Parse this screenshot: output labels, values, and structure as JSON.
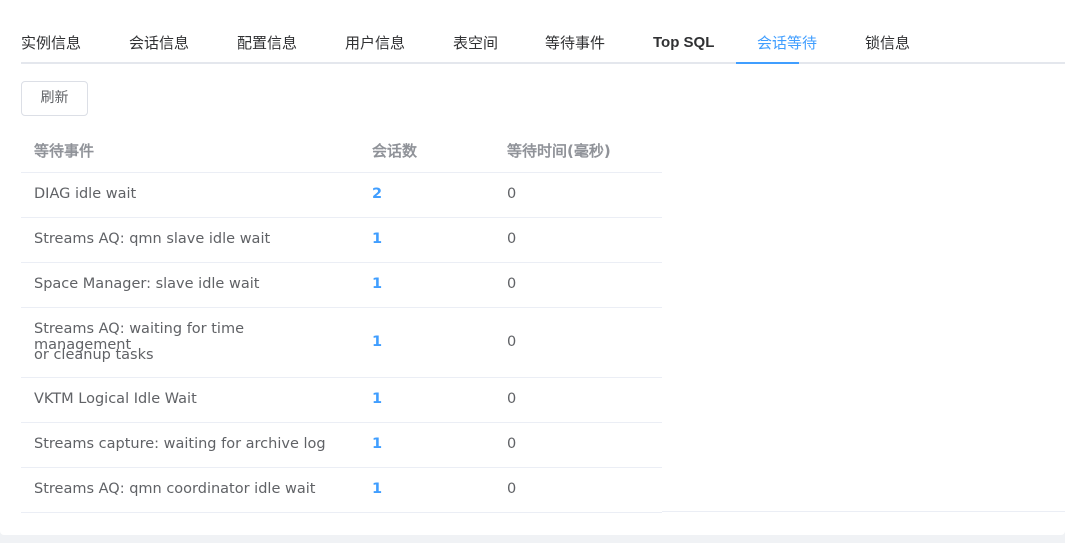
{
  "tabs": [
    {
      "label": "实例信息"
    },
    {
      "label": "会话信息"
    },
    {
      "label": "配置信息"
    },
    {
      "label": "用户信息"
    },
    {
      "label": "表空间"
    },
    {
      "label": "等待事件"
    },
    {
      "label": "Top SQL"
    },
    {
      "label": "会话等待",
      "active": true
    },
    {
      "label": "锁信息"
    }
  ],
  "toolbar": {
    "refresh_label": "刷新"
  },
  "table": {
    "columns": [
      "等待事件",
      "会话数",
      "等待时间(毫秒)"
    ],
    "rows": [
      {
        "event": "DIAG idle wait",
        "sessions": "2",
        "wait_ms": "0"
      },
      {
        "event": "Streams AQ: qmn slave idle wait",
        "sessions": "1",
        "wait_ms": "0"
      },
      {
        "event": "Space Manager: slave idle wait",
        "sessions": "1",
        "wait_ms": "0"
      },
      {
        "event": "Streams AQ: waiting for time management",
        "event_line2": "or cleanup tasks",
        "sessions": "1",
        "wait_ms": "0"
      },
      {
        "event": "VKTM Logical Idle Wait",
        "sessions": "1",
        "wait_ms": "0"
      },
      {
        "event": "Streams capture: waiting for archive log",
        "sessions": "1",
        "wait_ms": "0"
      },
      {
        "event": "Streams AQ: qmn coordinator idle wait",
        "sessions": "1",
        "wait_ms": "0"
      }
    ]
  },
  "colors": {
    "accent": "#409eff",
    "text": "#606266",
    "header_text": "#909399"
  }
}
